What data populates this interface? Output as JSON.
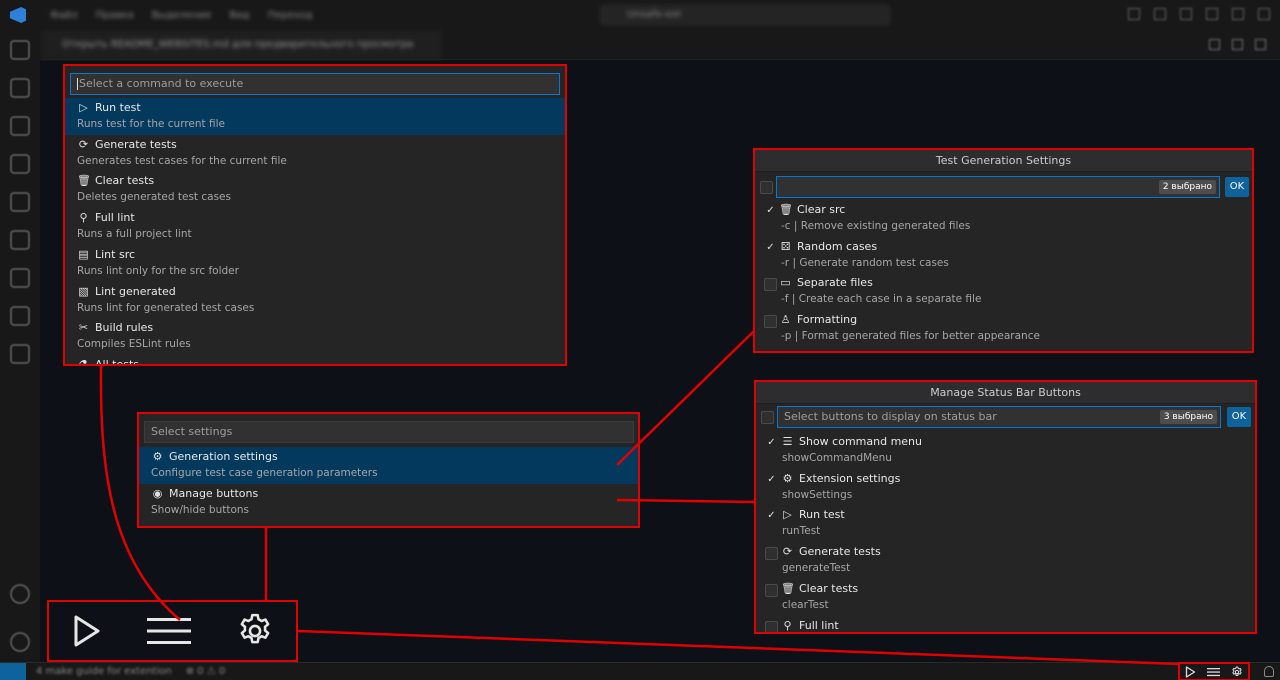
{
  "window": {
    "menu": [
      "Файл",
      "Правка",
      "Выделение",
      "Вид",
      "Переход"
    ],
    "search": "Unsafe-ext",
    "tab": "Открыть README_WEBSITES.md для предварительного просмотра"
  },
  "command_panel": {
    "placeholder": "Select a command to execute",
    "items": [
      {
        "icon": "play-icon",
        "label": "Run test",
        "desc": "Runs test for the current file",
        "selected": true
      },
      {
        "icon": "refresh-icon",
        "label": "Generate tests",
        "desc": "Generates test cases for the current file"
      },
      {
        "icon": "trash-icon",
        "label": "Clear tests",
        "desc": "Deletes generated test cases"
      },
      {
        "icon": "search-icon",
        "label": "Full lint",
        "desc": "Runs a full project lint"
      },
      {
        "icon": "file-icon",
        "label": "Lint src",
        "desc": "Runs lint only for the src folder"
      },
      {
        "icon": "file-check-icon",
        "label": "Lint generated",
        "desc": "Runs lint for generated test cases"
      },
      {
        "icon": "tools-icon",
        "label": "Build rules",
        "desc": "Compiles ESLint rules"
      },
      {
        "icon": "flask-icon",
        "label": "All tests",
        "desc": ""
      }
    ]
  },
  "settings_panel": {
    "placeholder": "Select settings",
    "items": [
      {
        "icon": "gear-icon",
        "label": "Generation settings",
        "desc": "Configure test case generation parameters",
        "selected": true
      },
      {
        "icon": "eye-icon",
        "label": "Manage buttons",
        "desc": "Show/hide buttons"
      }
    ]
  },
  "generation_panel": {
    "title": "Test Generation Settings",
    "badge": "2 выбрано",
    "ok": "OK",
    "items": [
      {
        "icon": "trash-icon",
        "label": "Clear src",
        "desc": "-c | Remove existing generated files",
        "checked": true
      },
      {
        "icon": "dice-icon",
        "label": "Random cases",
        "desc": "-r | Generate random test cases",
        "checked": true
      },
      {
        "icon": "folder-icon",
        "label": "Separate files",
        "desc": "-f | Create each case in a separate file",
        "checked": false
      },
      {
        "icon": "brush-icon",
        "label": "Formatting",
        "desc": "-p | Format generated files for better appearance",
        "checked": false
      }
    ]
  },
  "status_panel": {
    "title": "Manage Status Bar Buttons",
    "placeholder": "Select buttons to display on status bar",
    "badge": "3 выбрано",
    "ok": "OK",
    "items": [
      {
        "icon": "menu-icon",
        "label": "Show command menu",
        "desc": "showCommandMenu",
        "checked": true
      },
      {
        "icon": "gear-icon",
        "label": "Extension settings",
        "desc": "showSettings",
        "checked": true
      },
      {
        "icon": "play-icon",
        "label": "Run test",
        "desc": "runTest",
        "checked": true
      },
      {
        "icon": "refresh-icon",
        "label": "Generate tests",
        "desc": "generateTest",
        "checked": false
      },
      {
        "icon": "trash-icon",
        "label": "Clear tests",
        "desc": "clearTest",
        "checked": false
      },
      {
        "icon": "search-icon",
        "label": "Full lint",
        "desc": "",
        "checked": false
      }
    ]
  },
  "statusbar": {
    "message": "4 make guide for extention",
    "stats": "⊗ 0 ⚠ 0"
  },
  "colors": {
    "highlight": "#e00000",
    "selection": "#04395e",
    "accent": "#0e639c"
  }
}
